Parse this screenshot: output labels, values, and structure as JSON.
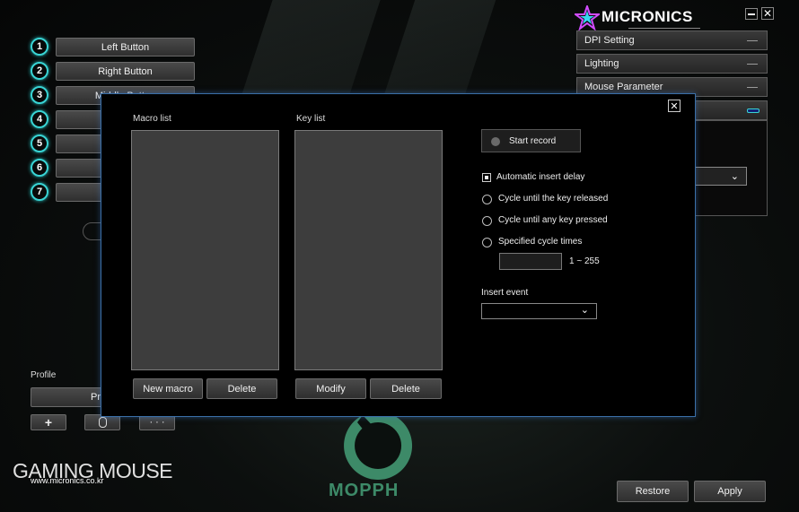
{
  "brand": {
    "name": "MICRONICS",
    "tagline": "Gaming Mouse"
  },
  "window_controls": {
    "minimize": "—",
    "close": "✕"
  },
  "buttons_panel": {
    "items": [
      {
        "num": "1",
        "label": "Left Button"
      },
      {
        "num": "2",
        "label": "Right Button"
      },
      {
        "num": "3",
        "label": "Middle Button"
      },
      {
        "num": "4",
        "label": ""
      },
      {
        "num": "5",
        "label": ""
      },
      {
        "num": "6",
        "label": ""
      },
      {
        "num": "7",
        "label": ""
      }
    ]
  },
  "right_panel": {
    "sections": [
      "DPI Setting",
      "Lighting",
      "Mouse Parameter"
    ]
  },
  "profile": {
    "label": "Profile",
    "current": "Pro",
    "add_label": "+",
    "more_label": "· · ·"
  },
  "footer": {
    "gaming_mouse": "GAMING MOUSE",
    "url": "www.micronics.co.kr",
    "logo_text": "MOPPH",
    "restore": "Restore",
    "apply": "Apply"
  },
  "macro_dialog": {
    "close": "✕",
    "macro_list_label": "Macro list",
    "key_list_label": "Key list",
    "new_macro": "New macro",
    "delete_macro": "Delete",
    "modify": "Modify",
    "delete_key": "Delete",
    "start_record": "Start record",
    "options": {
      "auto_delay": "Automatic insert delay",
      "cycle_released": "Cycle until the key released",
      "cycle_any_key": "Cycle until any key pressed",
      "specified_cycle": "Specified cycle times"
    },
    "cycle_range": "1 ~ 255",
    "cycle_value": "",
    "insert_event_label": "Insert event",
    "insert_event_value": ""
  }
}
